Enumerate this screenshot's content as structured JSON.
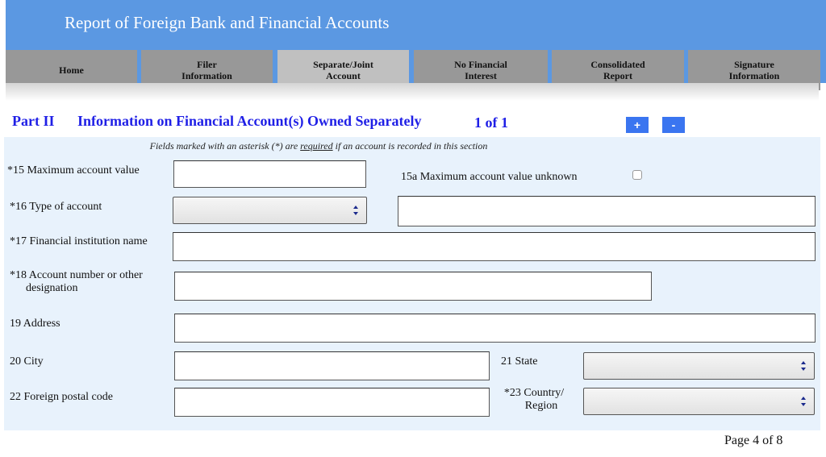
{
  "header": {
    "title": "Report of Foreign Bank and Financial Accounts"
  },
  "tabs": [
    {
      "line1": "Home",
      "line2": "",
      "active": false
    },
    {
      "line1": "Filer",
      "line2": "Information",
      "active": false
    },
    {
      "line1": "Separate/Joint",
      "line2": "Account",
      "active": true
    },
    {
      "line1": "No Financial",
      "line2": "Interest",
      "active": false
    },
    {
      "line1": "Consolidated",
      "line2": "Report",
      "active": false
    },
    {
      "line1": "Signature",
      "line2": "Information",
      "active": false
    }
  ],
  "part": {
    "label": "Part II",
    "title": "Information on Financial Account(s) Owned Separately",
    "count": "1 of 1",
    "add_label": "+",
    "remove_label": "-"
  },
  "note": {
    "prefix": "Fields marked with an asterisk (*) are ",
    "emphasis": "required",
    "suffix": " if an account is recorded in this section"
  },
  "fields": {
    "max_value": {
      "label": "*15 Maximum account value",
      "value": ""
    },
    "max_unknown": {
      "label": "15a Maximum account value unknown",
      "checked": false
    },
    "account_type": {
      "label": "*16 Type of account",
      "selected": "",
      "other_value": ""
    },
    "institution": {
      "label": "*17 Financial institution name",
      "value": ""
    },
    "account_number": {
      "label_line1": "*18 Account number or other",
      "label_line2": "designation",
      "value": ""
    },
    "address": {
      "label": "19  Address",
      "value": ""
    },
    "city": {
      "label": "20  City",
      "value": ""
    },
    "state": {
      "label": "21 State",
      "selected": ""
    },
    "postal": {
      "label": "22 Foreign postal code",
      "value": ""
    },
    "country": {
      "label_line1": "*23 Country/",
      "label_line2": "Region",
      "selected": ""
    }
  },
  "footer": {
    "page": "Page 4 of 8"
  }
}
